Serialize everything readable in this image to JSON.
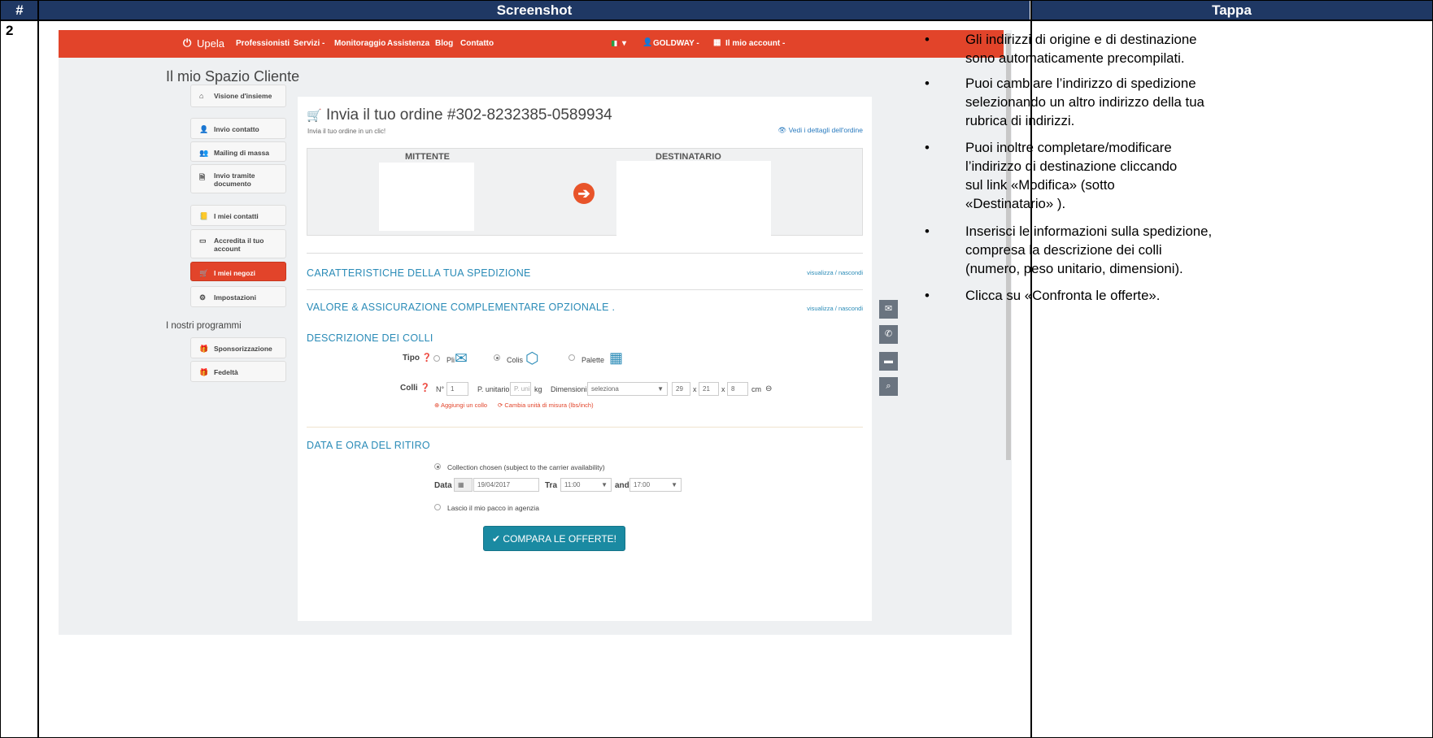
{
  "table": {
    "header_num": "#",
    "header_screenshot": "Screenshot",
    "header_step": "Tappa",
    "row_number": "2"
  },
  "nav": {
    "brand": "Upela",
    "items": [
      "Professionisti",
      "Servizi -",
      "Monitoraggio",
      "Assistenza",
      "Blog",
      "Contatto"
    ],
    "flag": "▾",
    "user": "GOLDWAY -",
    "account": "Il mio account -"
  },
  "page_title": "Il mio Spazio Cliente",
  "sidebar": {
    "items": [
      {
        "label": "Visione d'insieme"
      },
      {
        "label": "Invio contatto"
      },
      {
        "label": "Mailing di massa"
      },
      {
        "label": "Invio tramite",
        "label2": "documento"
      },
      {
        "label": "I miei contatti"
      },
      {
        "label": "Accredita il tuo",
        "label2": "account"
      },
      {
        "label": "I miei negozi"
      },
      {
        "label": "Impostazioni"
      }
    ],
    "programs_title": "I nostri programmi",
    "programs": [
      {
        "label": "Sponsorizzazione"
      },
      {
        "label": "Fedeltà"
      }
    ]
  },
  "order": {
    "title": "Invia il tuo ordine #302-8232385-0589934",
    "subtitle": "Invia il tuo ordine in un clic!",
    "details_link": "Vedi i dettagli dell'ordine",
    "sender_label": "MITTENTE",
    "recipient_label": "DESTINATARIO"
  },
  "sections": {
    "characteristics": "CARATTERISTICHE DELLA TUA SPEDIZIONE",
    "toggle": "visualizza / nascondi",
    "insurance": "VALORE & ASSICURAZIONE COMPLEMENTARE OPZIONALE .",
    "parcels": "DESCRIZIONE DEI COLLI",
    "pickup": "DATA E ORA DEL RITIRO"
  },
  "parcels": {
    "type_label": "Tipo",
    "opt_pli": "Pli",
    "opt_colis": "Colis",
    "opt_palette": "Palette",
    "colli_label": "Colli",
    "num_prefix": "N°",
    "num_value": "1",
    "unit_label": "P. unitario",
    "unit_placeholder": "P. uni",
    "kg": "kg",
    "dim_label": "Dimensioni",
    "dim_select": "seleziona",
    "dim_1": "29",
    "dim_2": "21",
    "dim_3": "8",
    "times": "x",
    "cm": "cm",
    "add_parcel": "Aggiungi un collo",
    "change_unit": "Cambia unità di misura (lbs/inch)"
  },
  "pickup": {
    "collection_option": "Collection chosen (subject to the carrier availability)",
    "date_label": "Data",
    "date_value": "19/04/2017",
    "between_label": "Tra",
    "time_from": "11:00",
    "and_label": "and",
    "time_to": "17:00",
    "agency_option": "Lascio il mio pacco in agenzia"
  },
  "compare_button": "COMPARA LE OFFERTE!",
  "instructions": [
    "Gli indirizzi di origine e di destinazione",
    "sono automaticamente precompilati.",
    "Puoi cambiare l’indirizzo di spedizione",
    "selezionando un altro indirizzo della tua",
    "rubrica di indirizzi.",
    "Puoi inoltre completare/modificare",
    "l’indirizzo di destinazione cliccando",
    "sul link  «Modifica» (sotto",
    "«Destinatario»  ).",
    "Inserisci le informazioni sulla spedizione,",
    "compresa la descrizione dei colli",
    "(numero, peso unitario, dimensioni).",
    "Clicca su «Confronta le offerte»."
  ],
  "bullet": "•"
}
